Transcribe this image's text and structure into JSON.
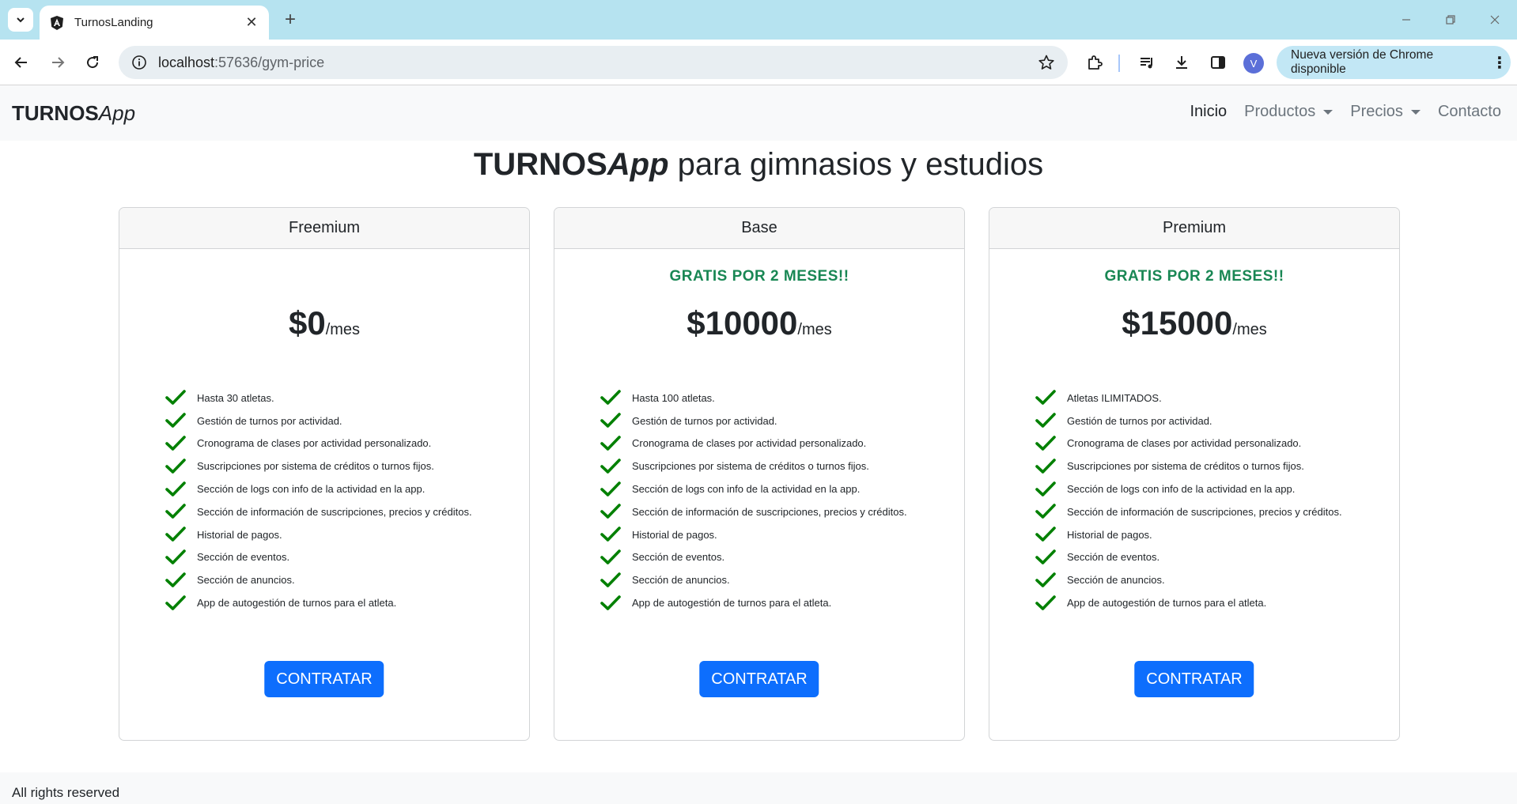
{
  "browser": {
    "tab_title": "TurnosLanding",
    "url_host": "localhost",
    "url_rest": ":57636/gym-price",
    "avatar_letter": "V",
    "update_text": "Nueva versión de Chrome disponible"
  },
  "navbar": {
    "brand_bold": "TURNOS",
    "brand_italic": "App",
    "links": [
      {
        "label": "Inicio"
      },
      {
        "label": "Productos"
      },
      {
        "label": "Precios"
      },
      {
        "label": "Contacto"
      }
    ]
  },
  "page": {
    "title_bold": "TURNOS",
    "title_italic": "App",
    "title_rest": " para gimnasios y estudios"
  },
  "plans": [
    {
      "name": "Freemium",
      "promo": "",
      "price": "$0",
      "period": "/mes",
      "features": [
        "Hasta 30 atletas.",
        "Gestión de turnos por actividad.",
        "Cronograma de clases por actividad personalizado.",
        "Suscripciones por sistema de créditos o turnos fijos.",
        "Sección de logs con info de la actividad en la app.",
        "Sección de información de suscripciones, precios y créditos.",
        "Historial de pagos.",
        "Sección de eventos.",
        "Sección de anuncios.",
        "App de autogestión de turnos para el atleta."
      ],
      "cta": "CONTRATAR"
    },
    {
      "name": "Base",
      "promo": "GRATIS POR 2 MESES!!",
      "price": "$10000",
      "period": "/mes",
      "features": [
        "Hasta 100 atletas.",
        "Gestión de turnos por actividad.",
        "Cronograma de clases por actividad personalizado.",
        "Suscripciones por sistema de créditos o turnos fijos.",
        "Sección de logs con info de la actividad en la app.",
        "Sección de información de suscripciones, precios y créditos.",
        "Historial de pagos.",
        "Sección de eventos.",
        "Sección de anuncios.",
        "App de autogestión de turnos para el atleta."
      ],
      "cta": "CONTRATAR"
    },
    {
      "name": "Premium",
      "promo": "GRATIS POR 2 MESES!!",
      "price": "$15000",
      "period": "/mes",
      "features": [
        "Atletas ILIMITADOS.",
        "Gestión de turnos por actividad.",
        "Cronograma de clases por actividad personalizado.",
        "Suscripciones por sistema de créditos o turnos fijos.",
        "Sección de logs con info de la actividad en la app.",
        "Sección de información de suscripciones, precios y créditos.",
        "Historial de pagos.",
        "Sección de eventos.",
        "Sección de anuncios.",
        "App de autogestión de turnos para el atleta."
      ],
      "cta": "CONTRATAR"
    }
  ],
  "footer": {
    "text": "All rights reserved"
  },
  "colors": {
    "tabstrip": "#b6e3f0",
    "primary": "#0d6efd",
    "promo_green": "#198754",
    "check_green": "#008000"
  }
}
